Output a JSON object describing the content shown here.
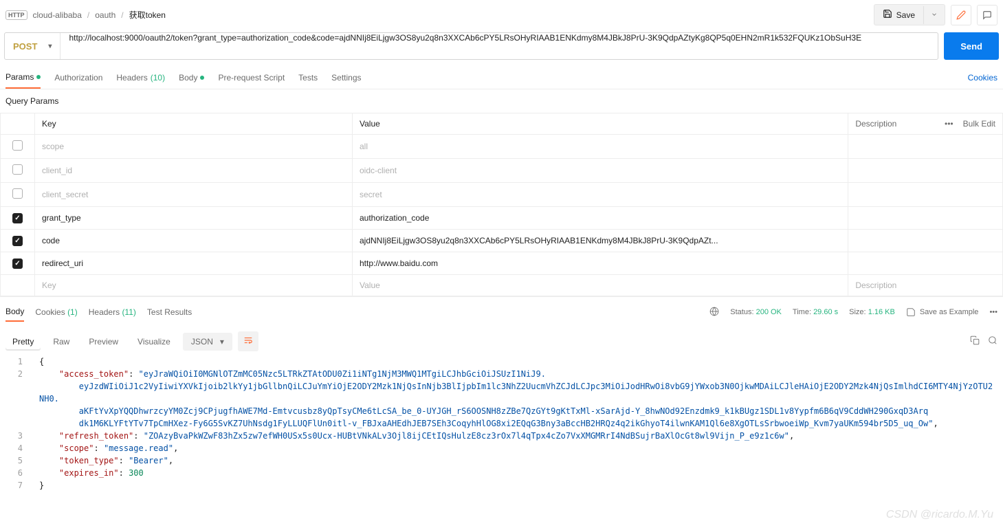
{
  "breadcrumb": {
    "root": "cloud-alibaba",
    "mid": "oauth",
    "current": "获取token"
  },
  "top": {
    "save_label": "Save"
  },
  "request": {
    "method": "POST",
    "url": "http://localhost:9000/oauth2/token?grant_type=authorization_code&code=ajdNNIj8EiLjgw3OS8yu2q8n3XXCAb6cPY5LRsOHyRIAAB1ENKdmy8M4JBkJ8PrU-3K9QdpAZtyKg8QP5q0EHN2mR1k532FQUKz1ObSuH3E",
    "send_label": "Send"
  },
  "tabs": {
    "params": "Params",
    "authorization": "Authorization",
    "headers": "Headers",
    "headers_count": "(10)",
    "body": "Body",
    "prerequest": "Pre-request Script",
    "tests": "Tests",
    "settings": "Settings",
    "cookies_link": "Cookies"
  },
  "params": {
    "title": "Query Params",
    "cols": {
      "key": "Key",
      "value": "Value",
      "description": "Description",
      "bulk": "Bulk Edit"
    },
    "rows": [
      {
        "enabled": false,
        "key": "scope",
        "value": "all"
      },
      {
        "enabled": false,
        "key": "client_id",
        "value": "oidc-client"
      },
      {
        "enabled": false,
        "key": "client_secret",
        "value": "secret"
      },
      {
        "enabled": true,
        "key": "grant_type",
        "value": "authorization_code"
      },
      {
        "enabled": true,
        "key": "code",
        "value": "ajdNNIj8EiLjgw3OS8yu2q8n3XXCAb6cPY5LRsOHyRIAAB1ENKdmy8M4JBkJ8PrU-3K9QdpAZt..."
      },
      {
        "enabled": true,
        "key": "redirect_uri",
        "value": "http://www.baidu.com"
      }
    ],
    "placeholder": {
      "key": "Key",
      "value": "Value",
      "description": "Description"
    }
  },
  "response": {
    "tabs": {
      "body": "Body",
      "cookies": "Cookies",
      "cookies_ct": "(1)",
      "headers": "Headers",
      "headers_ct": "(11)",
      "test_results": "Test Results"
    },
    "meta": {
      "status_lbl": "Status:",
      "status_val": "200 OK",
      "time_lbl": "Time:",
      "time_val": "29.60 s",
      "size_lbl": "Size:",
      "size_val": "1.16 KB",
      "save_example": "Save as Example"
    },
    "view": {
      "pretty": "Pretty",
      "raw": "Raw",
      "preview": "Preview",
      "visualize": "Visualize",
      "format": "JSON"
    },
    "json": {
      "access_token": "eyJraWQiOiI0MGNlOTZmMC05Nzc5LTRkZTAtODU0Zi1iNTg1NjM3MWQ1MTgiLCJhbGciOiJSUzI1NiJ9.eyJzdWIiOiJ1c2VyIiwiYXVkIjoib2lkYy1jbGllbnQiLCJuYmYiOjE2ODY2Mzk1NjQsInNjb3BlIjpbIm1lc3NhZ2UucmVhZCJdLCJpc3MiOiJodHRwOi8vbG9jYWxob3N0OjkwMDAiLCJleHAiOjE2ODY2Mzk4NjQsImlhdCI6MTY4NjYzOTU2NH0.aKFtYvXpYQQDhwrzcyYM0Zcj9CPjugfhAWE7Md-Emtvcusbz8yQpTsyCMe6tLcSA_be_0-UYJGH_rS6OOSNH8zZBe7QzGYt9gKtTxMl-xSarAjd-Y_8hwNOd92Enzdmk9_k1kBUgz1SDL1v8Yypfm6B6qV9CddWH290GxqD3Arqdk1M6KLYFtYTv7TpCmHXez-Fy6G5SvKZ7UhNsdg1FyLLUQFlUn0itl-v_FBJxaAHEdhJEB7SEh3CoqyhHlOG8xi2EQqG3Bny3aBccHB2HRQz4q2ikGhyoT4ilwnKAM1Ql6e8XgOTLsSrbwoeiWp_Kvm7yaUKm594br5D5_uq_Ow",
      "refresh_token": "ZOAzyBvaPkWZwF83hZx5zw7efWH0USx5s0Ucx-HUBtVNkALv3Ojl8ijCEtIQsHulzE8cz3rOx7l4qTpx4cZo7VxXMGMRrI4NdBSujrBaXlOcGt8wl9Vijn_P_e9z1c6w",
      "scope": "message.read",
      "token_type": "Bearer",
      "expires_in": 300
    }
  },
  "watermark": "CSDN @ricardo.M.Yu"
}
